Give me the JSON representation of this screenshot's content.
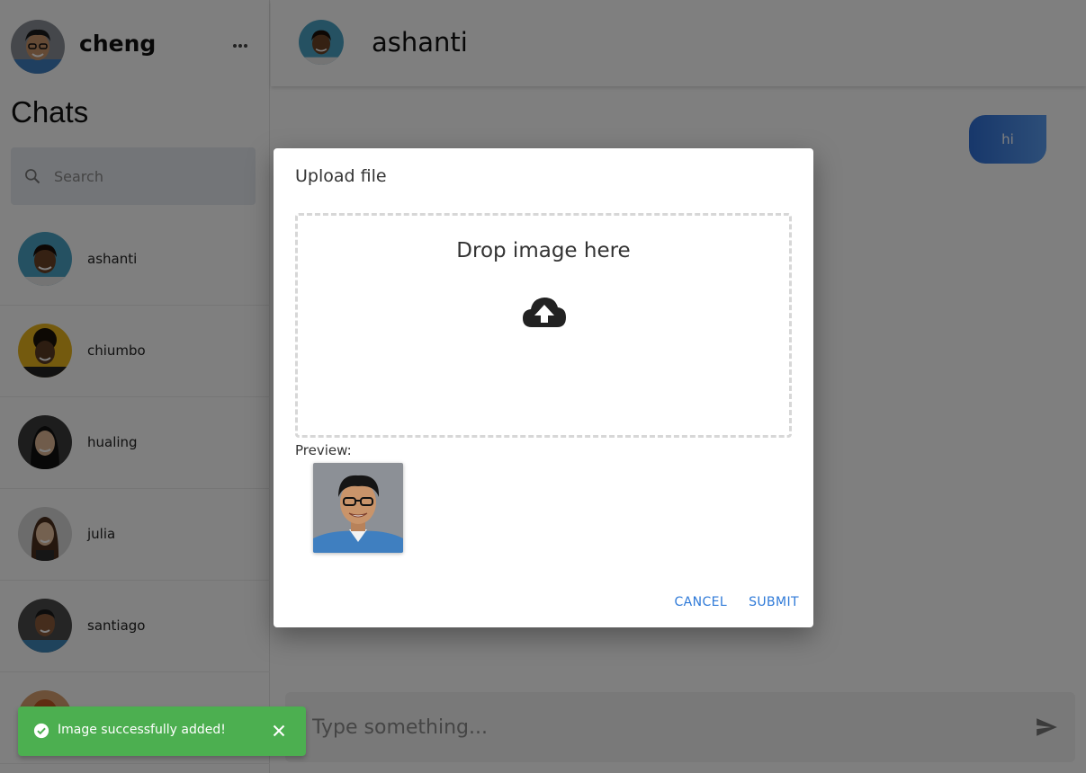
{
  "current_user": {
    "name": "cheng",
    "avatar_icon": "user-avatar-cheng"
  },
  "sidebar": {
    "title": "Chats",
    "search_placeholder": "Search",
    "contacts": [
      {
        "name": "ashanti"
      },
      {
        "name": "chiumbo"
      },
      {
        "name": "hualing"
      },
      {
        "name": "julia"
      },
      {
        "name": "santiago"
      }
    ]
  },
  "chat": {
    "contact_name": "ashanti",
    "messages": [
      {
        "text": "hi",
        "direction": "outgoing"
      }
    ],
    "composer_placeholder": "Type something..."
  },
  "modal": {
    "title": "Upload file",
    "dropzone_text": "Drop image here",
    "preview_label": "Preview:",
    "cancel_label": "CANCEL",
    "submit_label": "SUBMIT"
  },
  "snackbar": {
    "message": "Image successfully added!",
    "color": "#4caf50"
  },
  "colors": {
    "accent": "#2f7ad8",
    "bubble": "#3a7fe0",
    "success": "#4caf50"
  }
}
